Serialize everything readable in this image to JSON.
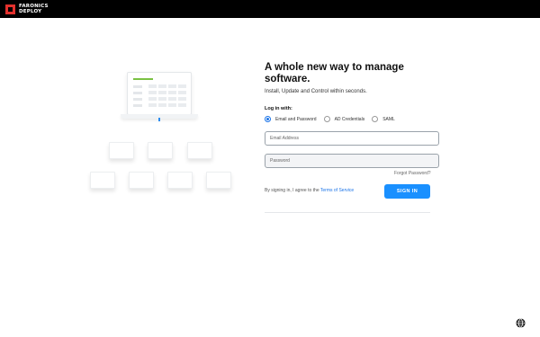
{
  "brand": {
    "line1": "FARONICS",
    "line2": "DEPLOY",
    "accent": "#e3312d"
  },
  "login": {
    "title": "A whole new way to manage software.",
    "subtitle": "Install, Update and Control within seconds.",
    "login_with_label": "Log in with:",
    "options": [
      {
        "label": "Email and Password",
        "selected": true
      },
      {
        "label": "AD Credentials",
        "selected": false
      },
      {
        "label": "SAML",
        "selected": false
      }
    ],
    "email_placeholder": "Email Address",
    "password_placeholder": "Password",
    "forgot_label": "Forgot Password?",
    "agree_text": "By signing in, I agree to the ",
    "terms_label": "Terms of Service",
    "signin_label": "SIGN IN",
    "primary_color": "#1a90ff"
  },
  "footer": {
    "language_icon": "globe-icon"
  }
}
